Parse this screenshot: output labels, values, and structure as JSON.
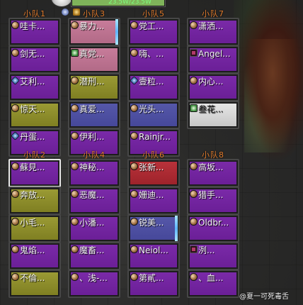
{
  "top_frame": {
    "hp_text": "23.5W/23.5W",
    "hp_fraction": 1.0
  },
  "groups": [
    {
      "title": "小队1",
      "members": [
        {
          "name": "哇卡...",
          "color": "purple",
          "icon": "class-icon"
        },
        {
          "name": "剑无...",
          "color": "purple",
          "icon": "class-icon"
        },
        {
          "name": "艾利...",
          "color": "purple",
          "icon": "shield-icon"
        },
        {
          "name": "惊天...",
          "color": "yellow",
          "icon": "class-icon"
        },
        {
          "name": "丹蛋...",
          "color": "purple",
          "icon": "shield-icon"
        }
      ]
    },
    {
      "title": "小队2",
      "members": [
        {
          "name": "蘇見...",
          "color": "purple",
          "icon": "class-icon",
          "selected": true
        },
        {
          "name": "奔放...",
          "color": "yellow",
          "icon": "class-icon"
        },
        {
          "name": "小毛...",
          "color": "yellow",
          "icon": "class-icon"
        },
        {
          "name": "鬼焰...",
          "color": "purple",
          "icon": "class-icon"
        },
        {
          "name": "不倫...",
          "color": "yellow",
          "icon": "class-icon"
        }
      ]
    },
    {
      "title": "小队3",
      "members": [
        {
          "name": "暴力...",
          "color": "pink",
          "icon": "class-icon",
          "mana": true
        },
        {
          "name": "真党...",
          "color": "pink",
          "icon": "heal-icon"
        },
        {
          "name": "潜刑...",
          "color": "yellow",
          "icon": "class-icon"
        },
        {
          "name": "真爱...",
          "color": "blue",
          "icon": "class-icon"
        },
        {
          "name": "伊利...",
          "color": "purple",
          "icon": "class-icon"
        }
      ]
    },
    {
      "title": "小队4",
      "members": [
        {
          "name": "神秘...",
          "color": "purple",
          "icon": "class-icon"
        },
        {
          "name": "恶魔...",
          "color": "purple",
          "icon": "class-icon"
        },
        {
          "name": "小潘...",
          "color": "purple",
          "icon": "class-icon"
        },
        {
          "name": "魔畜...",
          "color": "purple",
          "icon": "class-icon"
        },
        {
          "name": "、浅-...",
          "color": "purple",
          "icon": "class-icon"
        }
      ]
    },
    {
      "title": "小队5",
      "members": [
        {
          "name": "党工...",
          "color": "purple",
          "icon": "class-icon"
        },
        {
          "name": "嗨、...",
          "color": "purple",
          "icon": "class-icon"
        },
        {
          "name": "壹粒...",
          "color": "purple",
          "icon": "shield-icon"
        },
        {
          "name": "光头...",
          "color": "blue",
          "icon": "class-icon"
        },
        {
          "name": "Rainjr...",
          "color": "purple",
          "icon": "class-icon"
        }
      ]
    },
    {
      "title": "小队6",
      "members": [
        {
          "name": "张新...",
          "color": "red",
          "icon": "class-icon"
        },
        {
          "name": "姗迪...",
          "color": "purple",
          "icon": "class-icon"
        },
        {
          "name": "锐美...",
          "color": "blue",
          "icon": "class-icon",
          "mana": true
        },
        {
          "name": "Neiol...",
          "color": "purple",
          "icon": "class-icon"
        },
        {
          "name": "第貳...",
          "color": "purple",
          "icon": "class-icon"
        }
      ]
    },
    {
      "title": "小队7",
      "members": [
        {
          "name": "潇洒...",
          "color": "purple",
          "icon": "class-icon"
        },
        {
          "name": "Angel...",
          "color": "purple",
          "icon": "debuff-icon"
        },
        {
          "name": "内心...",
          "color": "purple",
          "icon": "class-icon"
        },
        {
          "name": "叁花...",
          "color": "white",
          "icon": "heal-icon"
        },
        {
          "name": "",
          "color": "none",
          "icon": ""
        }
      ]
    },
    {
      "title": "小队8",
      "members": [
        {
          "name": "高坂...",
          "color": "purple",
          "icon": "class-icon"
        },
        {
          "name": "猎手...",
          "color": "purple",
          "icon": "class-icon"
        },
        {
          "name": "Oldbr...",
          "color": "purple",
          "icon": "class-icon"
        },
        {
          "name": "洌...",
          "color": "purple",
          "icon": "debuff-icon"
        },
        {
          "name": "、血...",
          "color": "purple",
          "icon": "class-icon"
        }
      ]
    }
  ],
  "watermark": "@夏一可死毒舌"
}
